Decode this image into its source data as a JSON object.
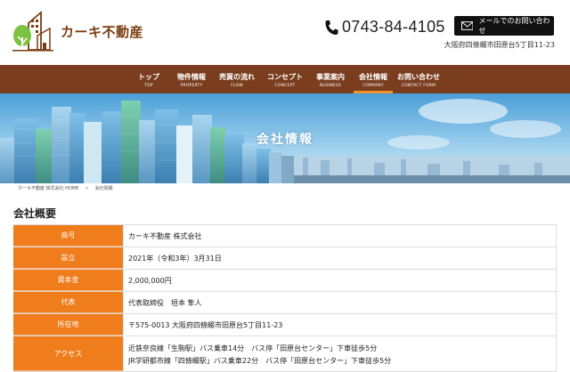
{
  "header": {
    "company_name": "カーキ不動産",
    "phone": "0743-84-4105",
    "mail_button": "メールでのお問い合わせ",
    "address": "大阪府四條畷市田原台5丁目11-23"
  },
  "nav": {
    "items": [
      {
        "jp": "トップ",
        "en": "TOP"
      },
      {
        "jp": "物件情報",
        "en": "PROPERTY"
      },
      {
        "jp": "売買の流れ",
        "en": "FLOW"
      },
      {
        "jp": "コンセプト",
        "en": "CONCEPT"
      },
      {
        "jp": "事業案内",
        "en": "BUSINESS"
      },
      {
        "jp": "会社情報",
        "en": "COMPANY"
      },
      {
        "jp": "お問い合わせ",
        "en": "CONTACT FORM"
      }
    ],
    "active_index": 5
  },
  "hero": {
    "title": "会社情報"
  },
  "breadcrumb": {
    "home": "カーキ不動産 株式会社 HOME",
    "separator": "»",
    "current": "会社情報"
  },
  "section": {
    "title": "会社概要"
  },
  "company_table": [
    {
      "label": "商号",
      "value": "カーキ不動産 株式会社"
    },
    {
      "label": "設立",
      "value": "2021年（令和3年）3月31日"
    },
    {
      "label": "資本金",
      "value": "2,000,000円"
    },
    {
      "label": "代表",
      "value": "代表取締役　垣本 隼人"
    },
    {
      "label": "所在地",
      "value": "〒575-0013 大阪府四條畷市田原台5丁目11-23"
    },
    {
      "label": "アクセス",
      "lines": [
        "近鉄奈良線「生駒駅」バス乗車14分　バス停「田原台センター」下車徒歩5分",
        "JR学研都市線「四條畷駅」バス乗車22分　バス停「田原台センター」下車徒歩5分"
      ]
    }
  ],
  "colors": {
    "nav_bg": "#7a3d1e",
    "accent": "#f07d1c",
    "active_bar": "#f0932a",
    "logo_text": "#7a3d10"
  }
}
